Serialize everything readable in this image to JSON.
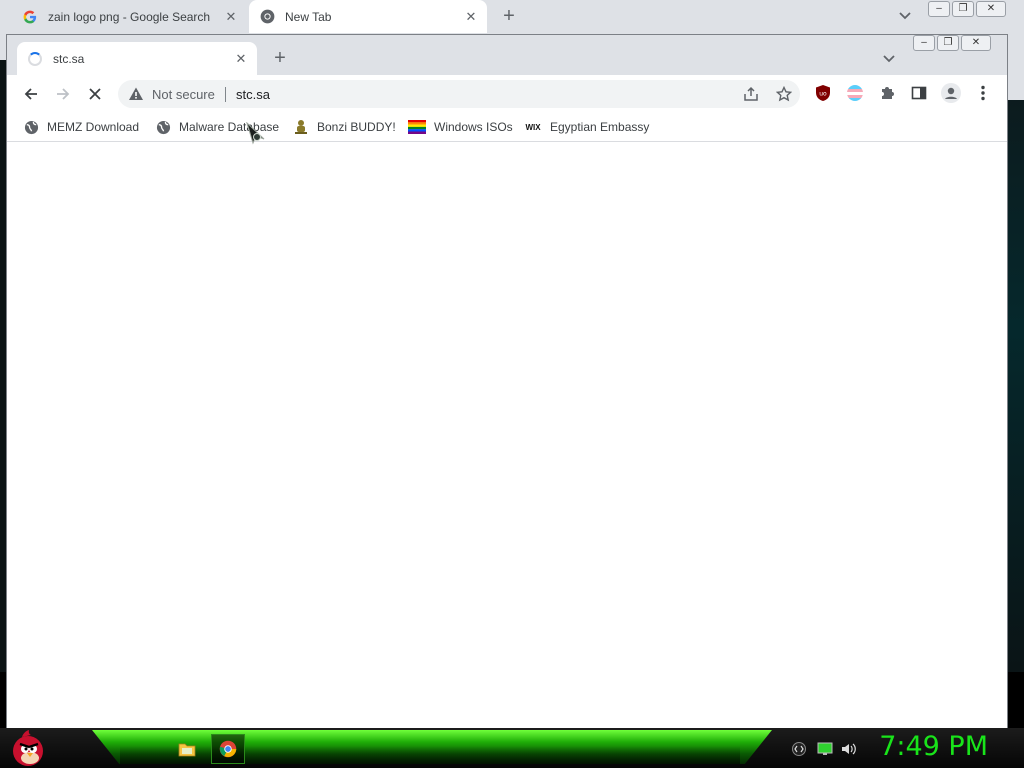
{
  "background_window": {
    "tabs": [
      {
        "label": "zain logo png - Google Search",
        "icon": "google-g-icon"
      },
      {
        "label": "New Tab",
        "icon": "chrome-icon"
      }
    ],
    "new_tab_symbol": "+",
    "tab_search_symbol": "⌄",
    "window_controls": {
      "minimize": "–",
      "restore": "❐",
      "close": "✕"
    }
  },
  "window": {
    "tabs": [
      {
        "label": "stc.sa",
        "icon": "loading-spinner-icon",
        "close": "✕"
      }
    ],
    "new_tab_symbol": "+",
    "tab_search_symbol": "⌄",
    "window_controls": {
      "minimize": "–",
      "restore": "❐",
      "close": "✕"
    }
  },
  "toolbar": {
    "security_label": "Not secure",
    "url": "stc.sa"
  },
  "bookmarks": [
    {
      "label": "MEMZ Download",
      "icon": "globe-icon"
    },
    {
      "label": "Malware Database",
      "icon": "globe-icon"
    },
    {
      "label": "Bonzi BUDDY!",
      "icon": "bonzi-icon"
    },
    {
      "label": "Windows ISOs",
      "icon": "rainbow-flag-icon"
    },
    {
      "label": "Egyptian Embassy",
      "icon": "wix-icon"
    }
  ],
  "bookmark_wix_text": "WIX",
  "extensions": [
    "ublock-icon",
    "trans-flag-icon",
    "puzzle-icon",
    "side-panel-icon",
    "profile-icon",
    "menu-icon"
  ],
  "taskbar": {
    "clock": "7:49 PM",
    "apps": [
      "file-explorer-icon",
      "chrome-icon"
    ],
    "tray": [
      "language-icon",
      "network-icon",
      "volume-icon"
    ]
  },
  "colors": {
    "clock": "#19e41a",
    "taskbar_glow": "#1fae08",
    "tabstrip": "#dee1e6"
  }
}
